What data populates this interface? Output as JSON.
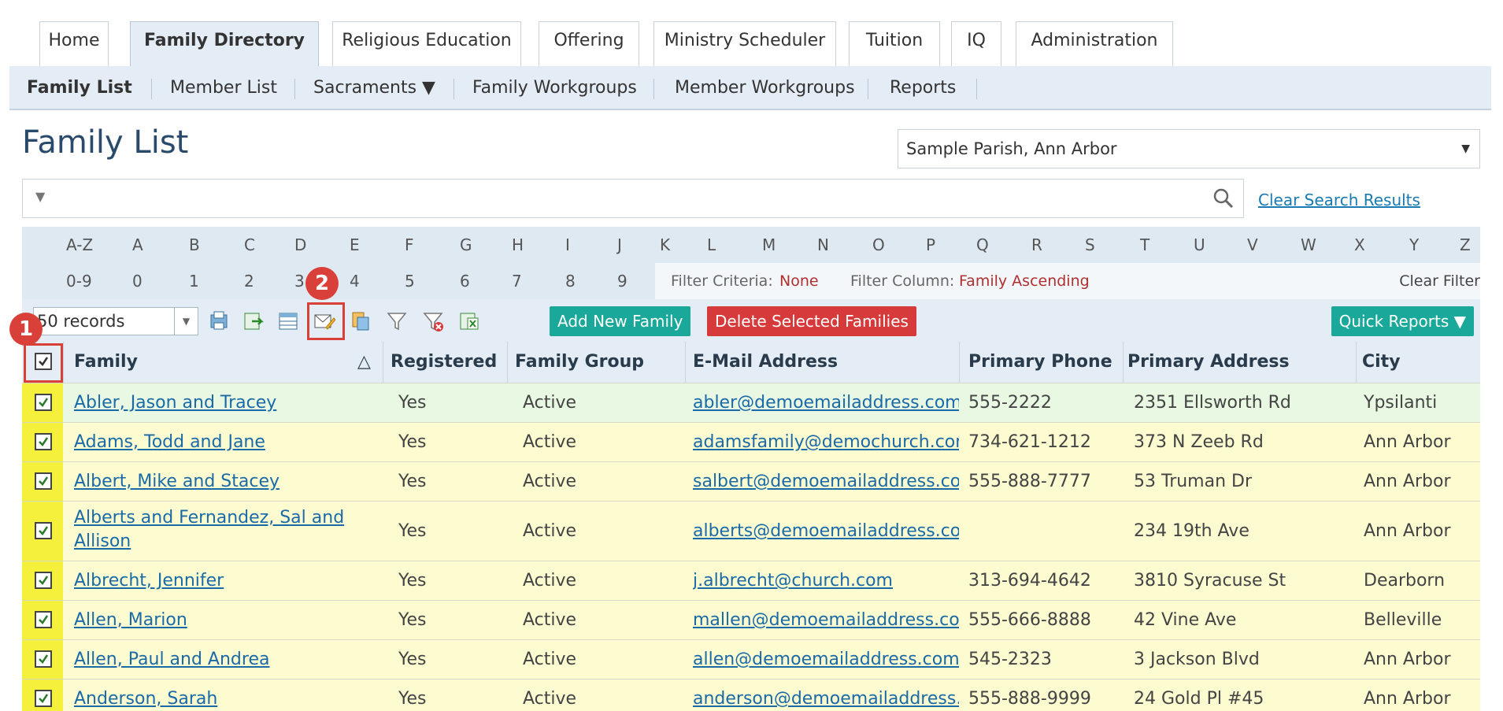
{
  "top_tabs": [
    "Home",
    "Family Directory",
    "Religious Education",
    "Offering",
    "Ministry Scheduler",
    "Tuition",
    "IQ",
    "Administration"
  ],
  "subnav": {
    "items": [
      "Family List",
      "Member List",
      "Sacraments ▼",
      "Family Workgroups",
      "Member Workgroups",
      "Reports"
    ]
  },
  "page_title": "Family List",
  "parish": "Sample Parish, Ann Arbor",
  "clear_search": "Clear Search Results",
  "letters": [
    "A-Z",
    "A",
    "B",
    "C",
    "D",
    "E",
    "F",
    "G",
    "H",
    "I",
    "J",
    "K",
    "L",
    "M",
    "N",
    "O",
    "P",
    "Q",
    "R",
    "S",
    "T",
    "U",
    "V",
    "W",
    "X",
    "Y",
    "Z"
  ],
  "digits": [
    "0-9",
    "0",
    "1",
    "2",
    "3",
    "4",
    "5",
    "6",
    "7",
    "8",
    "9"
  ],
  "filter": {
    "criteria_label": "Filter Criteria:",
    "criteria_value": "None",
    "column_label": "Filter Column:",
    "column_value": "Family Ascending",
    "clear": "Clear Filter"
  },
  "toolbar": {
    "records": "50 records",
    "add_family": "Add New Family",
    "delete_families": "Delete Selected Families",
    "quick_reports": "Quick Reports ▼"
  },
  "markers": {
    "one": "1",
    "two": "2"
  },
  "columns": [
    "Family",
    "Registered",
    "Family Group",
    "E-Mail Address",
    "Primary Phone",
    "Primary Address",
    "City"
  ],
  "sort_indicator": "△",
  "rows": [
    {
      "family": "Abler, Jason and Tracey",
      "registered": "Yes",
      "group": "Active",
      "email": "abler@demoemailaddress.com",
      "phone": "555-2222",
      "address": "2351 Ellsworth Rd",
      "city": "Ypsilanti"
    },
    {
      "family": "Adams, Todd and Jane",
      "registered": "Yes",
      "group": "Active",
      "email": "adamsfamily@demochurch.com",
      "phone": "734-621-1212",
      "address": "373 N Zeeb Rd",
      "city": "Ann Arbor"
    },
    {
      "family": "Albert, Mike and Stacey",
      "registered": "Yes",
      "group": "Active",
      "email": "salbert@demoemailaddress.com",
      "phone": "555-888-7777",
      "address": "53 Truman Dr",
      "city": "Ann Arbor"
    },
    {
      "family": "Alberts and Fernandez, Sal and",
      "family2": "Allison",
      "registered": "Yes",
      "group": "Active",
      "email": "alberts@demoemailaddress.com",
      "phone": "",
      "address": "234 19th Ave",
      "city": "Ann Arbor"
    },
    {
      "family": "Albrecht, Jennifer",
      "registered": "Yes",
      "group": "Active",
      "email": "j.albrecht@church.com",
      "phone": "313-694-4642",
      "address": "3810 Syracuse St",
      "city": "Dearborn"
    },
    {
      "family": "Allen, Marion",
      "registered": "Yes",
      "group": "Active",
      "email": "mallen@demoemailaddress.com",
      "phone": "555-666-8888",
      "address": "42 Vine Ave",
      "city": "Belleville"
    },
    {
      "family": "Allen, Paul and Andrea",
      "registered": "Yes",
      "group": "Active",
      "email": "allen@demoemailaddress.com",
      "phone": "545-2323",
      "address": "3 Jackson Blvd",
      "city": "Ann Arbor"
    },
    {
      "family": "Anderson, Sarah",
      "registered": "Yes",
      "group": "Active",
      "email": "anderson@demoemailaddress.com",
      "phone": "555-888-9999",
      "address": "24 Gold Pl #45",
      "city": "Ann Arbor"
    }
  ],
  "colors": {
    "accent": "#1aa89a",
    "danger": "#d63a3a",
    "row_first": "#e8f8e2",
    "row": "#fdfbd0",
    "check_col": "#f5f03c"
  }
}
